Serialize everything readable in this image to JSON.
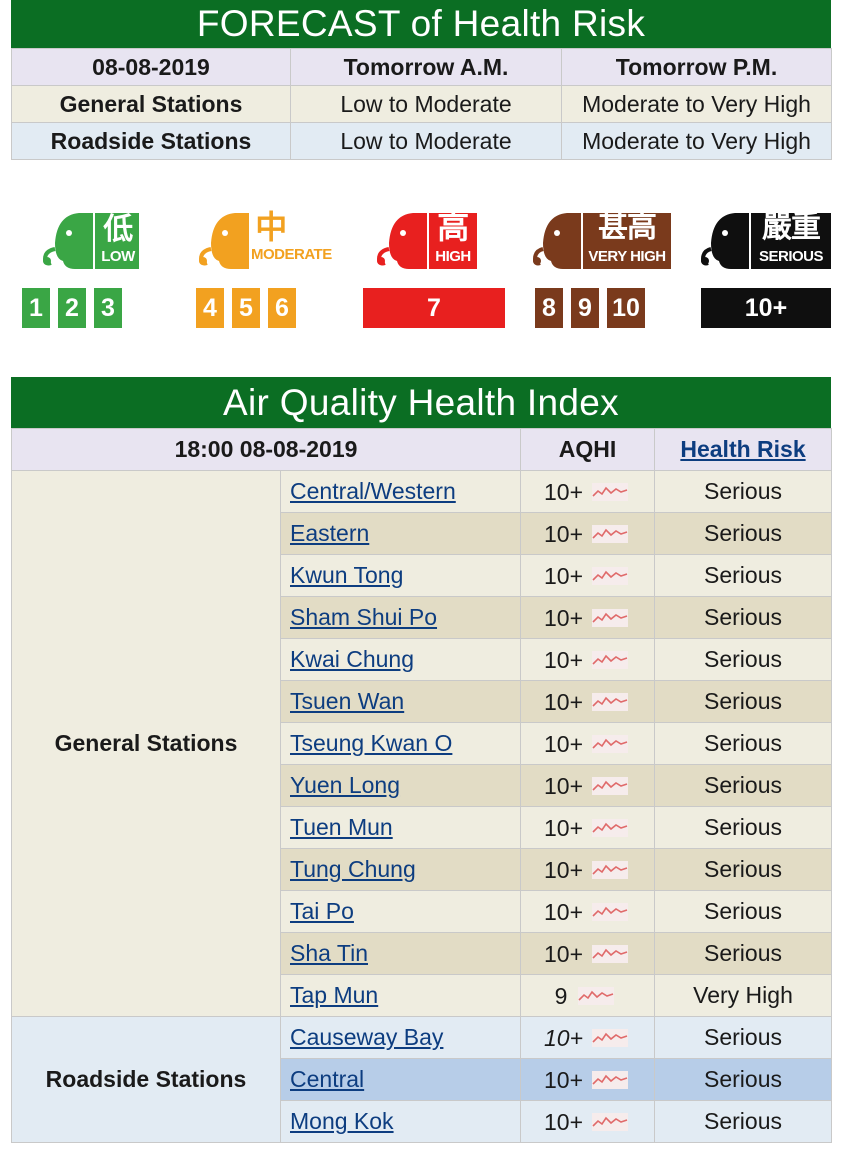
{
  "forecast": {
    "title": "FORECAST of Health Risk",
    "date": "08-08-2019",
    "col_am": "Tomorrow A.M.",
    "col_pm": "Tomorrow P.M.",
    "rows": [
      {
        "label": "General Stations",
        "am": "Low to Moderate",
        "pm": "Moderate to Very High"
      },
      {
        "label": "Roadside Stations",
        "am": "Low to Moderate",
        "pm": "Moderate to Very High"
      }
    ]
  },
  "legend": {
    "bands": [
      {
        "chinese": "低",
        "english": "LOW",
        "color": "#3aa645",
        "levels": [
          "1",
          "2",
          "3"
        ]
      },
      {
        "chinese": "中",
        "english": "MODERATE",
        "color": "#f2a120",
        "levels": [
          "4",
          "5",
          "6"
        ]
      },
      {
        "chinese": "高",
        "english": "HIGH",
        "color": "#e8201f",
        "levels": [
          "7"
        ]
      },
      {
        "chinese": "甚高",
        "english": "VERY HIGH",
        "color": "#7a3a1c",
        "levels": [
          "8",
          "9",
          "10"
        ]
      },
      {
        "chinese": "嚴重",
        "english": "SERIOUS",
        "color": "#0f0f0f",
        "levels": [
          "10+"
        ]
      }
    ]
  },
  "aqhi": {
    "title": "Air Quality Health Index",
    "timestamp": "18:00 08-08-2019",
    "col_aqhi": "AQHI",
    "col_risk": "Health Risk",
    "groups": [
      {
        "label": "General Stations",
        "stations": [
          {
            "name": "Central/Western",
            "aqhi": "10+",
            "risk": "Serious"
          },
          {
            "name": "Eastern",
            "aqhi": "10+",
            "risk": "Serious"
          },
          {
            "name": "Kwun Tong",
            "aqhi": "10+",
            "risk": "Serious"
          },
          {
            "name": "Sham Shui Po",
            "aqhi": "10+",
            "risk": "Serious"
          },
          {
            "name": "Kwai Chung",
            "aqhi": "10+",
            "risk": "Serious"
          },
          {
            "name": "Tsuen Wan",
            "aqhi": "10+",
            "risk": "Serious"
          },
          {
            "name": "Tseung Kwan O",
            "aqhi": "10+",
            "risk": "Serious"
          },
          {
            "name": "Yuen Long",
            "aqhi": "10+",
            "risk": "Serious"
          },
          {
            "name": "Tuen Mun",
            "aqhi": "10+",
            "risk": "Serious"
          },
          {
            "name": "Tung Chung",
            "aqhi": "10+",
            "risk": "Serious"
          },
          {
            "name": "Tai Po",
            "aqhi": "10+",
            "risk": "Serious"
          },
          {
            "name": "Sha Tin",
            "aqhi": "10+",
            "risk": "Serious"
          },
          {
            "name": "Tap Mun",
            "aqhi": "9",
            "risk": "Very High"
          }
        ]
      },
      {
        "label": "Roadside Stations",
        "stations": [
          {
            "name": "Causeway Bay",
            "aqhi": "10+",
            "risk": "Serious"
          },
          {
            "name": "Central",
            "aqhi": "10+",
            "risk": "Serious"
          },
          {
            "name": "Mong Kok",
            "aqhi": "10+",
            "risk": "Serious"
          }
        ]
      }
    ]
  },
  "icons": {
    "trend": "trend-chart-icon",
    "face": "elephant-face-icon"
  }
}
